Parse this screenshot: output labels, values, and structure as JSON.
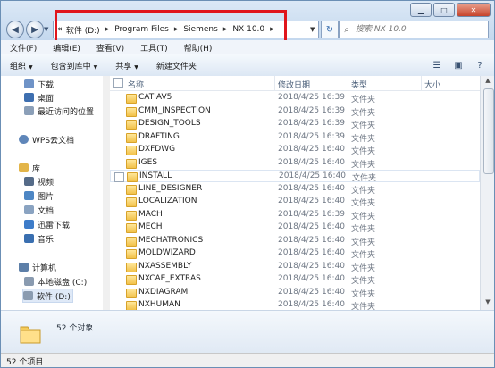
{
  "window": {
    "minimize": "▁",
    "maximize": "□",
    "close": "✕"
  },
  "address": {
    "overflow": "«",
    "crumbs": [
      "软件 (D:)",
      "Program Files",
      "Siemens",
      "NX 10.0"
    ],
    "separator": "▸",
    "search_placeholder": "搜索 NX 10.0"
  },
  "menu": [
    "文件(F)",
    "编辑(E)",
    "查看(V)",
    "工具(T)",
    "帮助(H)"
  ],
  "toolbar": {
    "organize": "组织",
    "include": "包含到库中",
    "share": "共享",
    "new_folder": "新建文件夹"
  },
  "nav": {
    "favorites": [
      {
        "label": "下载",
        "icon": "download-folder-icon",
        "color": "#6f93c7"
      },
      {
        "label": "桌面",
        "icon": "desktop-icon",
        "color": "#3e6fb0"
      },
      {
        "label": "最近访问的位置",
        "icon": "recent-places-icon",
        "color": "#8b9fb8"
      }
    ],
    "wps": {
      "label": "WPS云文档",
      "icon": "cloud-icon",
      "color": "#5f86b9"
    },
    "library": {
      "label": "库",
      "icon": "library-icon",
      "color": "#e3b549"
    },
    "library_items": [
      {
        "label": "视频",
        "icon": "video-icon",
        "color": "#556b88"
      },
      {
        "label": "图片",
        "icon": "pictures-icon",
        "color": "#4d86c4"
      },
      {
        "label": "文档",
        "icon": "documents-icon",
        "color": "#8aa3c1"
      },
      {
        "label": "迅雷下载",
        "icon": "thunder-download-icon",
        "color": "#3d7cc9"
      },
      {
        "label": "音乐",
        "icon": "music-icon",
        "color": "#3a6fb0"
      }
    ],
    "computer": {
      "label": "计算机",
      "icon": "computer-icon",
      "color": "#5d7fa8"
    },
    "drives": [
      {
        "label": "本地磁盘 (C:)",
        "icon": "drive-c-icon",
        "color": "#8a9bb0"
      },
      {
        "label": "软件 (D:)",
        "icon": "drive-d-icon",
        "color": "#8a9bb0"
      }
    ]
  },
  "columns": {
    "name": "名称",
    "date": "修改日期",
    "type": "类型",
    "size": "大小"
  },
  "files": [
    {
      "name": "CATIAV5",
      "date": "2018/4/25 16:39",
      "type": "文件夹"
    },
    {
      "name": "CMM_INSPECTION",
      "date": "2018/4/25 16:39",
      "type": "文件夹"
    },
    {
      "name": "DESIGN_TOOLS",
      "date": "2018/4/25 16:39",
      "type": "文件夹"
    },
    {
      "name": "DRAFTING",
      "date": "2018/4/25 16:39",
      "type": "文件夹"
    },
    {
      "name": "DXFDWG",
      "date": "2018/4/25 16:40",
      "type": "文件夹"
    },
    {
      "name": "IGES",
      "date": "2018/4/25 16:40",
      "type": "文件夹"
    },
    {
      "name": "INSTALL",
      "date": "2018/4/25 16:40",
      "type": "文件夹"
    },
    {
      "name": "LINE_DESIGNER",
      "date": "2018/4/25 16:40",
      "type": "文件夹"
    },
    {
      "name": "LOCALIZATION",
      "date": "2018/4/25 16:40",
      "type": "文件夹"
    },
    {
      "name": "MACH",
      "date": "2018/4/25 16:39",
      "type": "文件夹"
    },
    {
      "name": "MECH",
      "date": "2018/4/25 16:40",
      "type": "文件夹"
    },
    {
      "name": "MECHATRONICS",
      "date": "2018/4/25 16:40",
      "type": "文件夹"
    },
    {
      "name": "MOLDWIZARD",
      "date": "2018/4/25 16:40",
      "type": "文件夹"
    },
    {
      "name": "NXASSEMBLY",
      "date": "2018/4/25 16:40",
      "type": "文件夹"
    },
    {
      "name": "NXCAE_EXTRAS",
      "date": "2018/4/25 16:40",
      "type": "文件夹"
    },
    {
      "name": "NXDIAGRAM",
      "date": "2018/4/25 16:40",
      "type": "文件夹"
    },
    {
      "name": "NXHUMAN",
      "date": "2018/4/25 16:40",
      "type": "文件夹"
    }
  ],
  "hovered_row": "INSTALL",
  "details": {
    "count": "52 个对象"
  },
  "status": {
    "text": "52 个项目"
  }
}
